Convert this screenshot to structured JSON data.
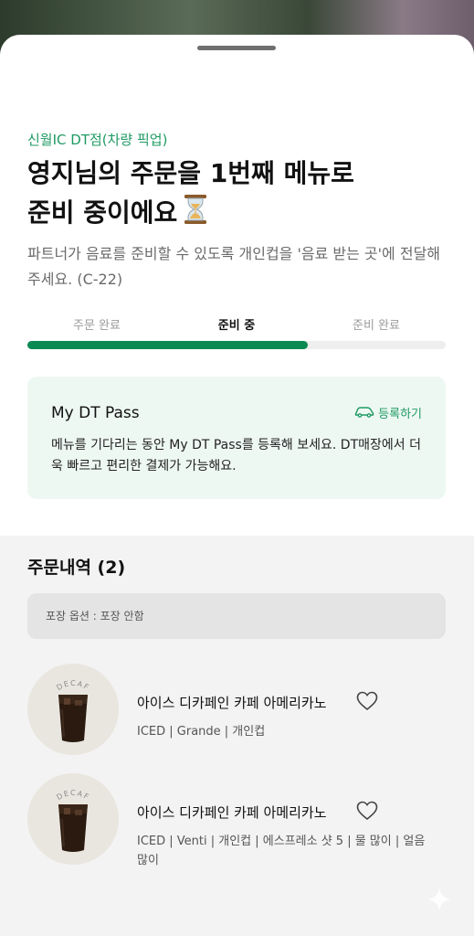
{
  "store_label": "신월IC DT점(차량 픽업)",
  "title_line1": "영지님의 주문을 1번째 메뉴로",
  "title_line2": "준비 중이에요",
  "description": "파트너가 음료를 준비할 수 있도록 개인컵을 '음료 받는 곳'에 전달해 주세요. (C-22)",
  "steps": [
    {
      "label": "주문 완료"
    },
    {
      "label": "준비 중"
    },
    {
      "label": "준비 완료"
    }
  ],
  "progress": 0.67,
  "pass_card": {
    "title": "My DT Pass",
    "register_label": "등록하기",
    "description": "메뉴를 기다리는 동안 My DT Pass를 등록해 보세요. DT매장에서 더욱 빠르고 편리한 결제가 가능해요."
  },
  "orders": {
    "title": "주문내역 (2)",
    "packaging_option": "포장 옵션 : 포장 안함",
    "items": [
      {
        "badge": "DECAF",
        "name": "아이스 디카페인 카페 아메리카노",
        "options": "ICED | Grande | 개인컵"
      },
      {
        "badge": "DECAF",
        "name": "아이스 디카페인 카페 아메리카노",
        "options": "ICED | Venti | 개인컵 | 에스프레소 샷 5 | 물 많이 | 얼음 많이"
      }
    ]
  },
  "colors": {
    "accent_green": "#0b8a52",
    "store_green": "#1f9a63",
    "pass_bg": "#eef8f3"
  },
  "icons": [
    "hourglass-icon",
    "car-icon",
    "heart-icon",
    "sparkle-icon"
  ]
}
